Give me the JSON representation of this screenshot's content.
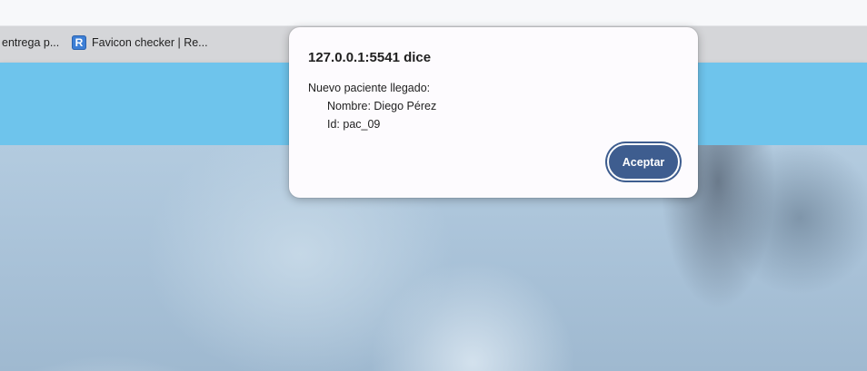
{
  "bookmarks_bar": {
    "items": [
      {
        "label": "entrega p...",
        "icon": "truncated-bookmark"
      },
      {
        "label": "Favicon checker | Re...",
        "icon": "favicon-r-icon",
        "icon_letter": "R"
      }
    ]
  },
  "colors": {
    "banner": "#6ec4ec",
    "accept_button": "#3e5d8f",
    "dialog_bg": "#fdfbfe"
  },
  "dialog": {
    "title": "127.0.0.1:5541 dice",
    "message_heading": "Nuevo paciente llegado:",
    "message_lines": [
      "Nombre: Diego Pérez",
      "Id: pac_09"
    ],
    "accept_label": "Aceptar"
  }
}
